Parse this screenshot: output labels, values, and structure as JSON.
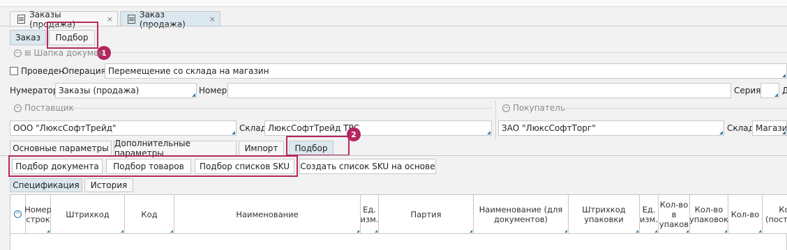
{
  "doc_tabs": [
    {
      "label": "Заказы (продажа)",
      "close": "×",
      "icon": "list-icon"
    },
    {
      "label": "Заказ (продажа)",
      "close": "×",
      "icon": "list-icon"
    }
  ],
  "form_tabs": [
    "Заказ",
    "Подбор"
  ],
  "callout_badges": [
    "1",
    "2"
  ],
  "header_group": {
    "title": "Шапка докумен"
  },
  "posted_checkbox_label": "Проведен",
  "operation": {
    "label": "Операция",
    "value": "Перемещение со склада на магазин"
  },
  "numerator": {
    "label": "Нумератор",
    "value": "Заказы (продажа)"
  },
  "number": {
    "label": "Номер",
    "value": ""
  },
  "series": {
    "label": "Серия",
    "value": "",
    "next_label": "Д"
  },
  "supplier_group": {
    "title": "Поставщик",
    "value": "ООО \"ЛюксСофтТрейд\""
  },
  "supplier_warehouse": {
    "label": "Склад",
    "value": "ЛюксСофтТрейд ТРС"
  },
  "buyer_group": {
    "title": "Покупатель",
    "value": "ЗАО \"ЛюксСофтТорг\""
  },
  "buyer_warehouse": {
    "label": "Склад",
    "value": "Магазин"
  },
  "section_tabs": [
    "Основные параметры",
    "Дополнительные параметры",
    "Импорт",
    "Подбор"
  ],
  "actions": [
    "Подбор документа",
    "Подбор товаров",
    "Подбор списков SKU",
    "Создать список SKU на основе"
  ],
  "list_tabs": [
    "Спецификация",
    "История"
  ],
  "table": {
    "columns": [
      "Номер строк",
      "Штрихкод",
      "Код",
      "Наименование",
      "Ед. изм.",
      "Партия",
      "Наименование (для документов)",
      "Штрихкод упаковки",
      "Ед. изм.",
      "Кол-во в упаков",
      "Кол-во упаковок",
      "Кол-во",
      "Кол-во (поставлено)"
    ]
  }
}
